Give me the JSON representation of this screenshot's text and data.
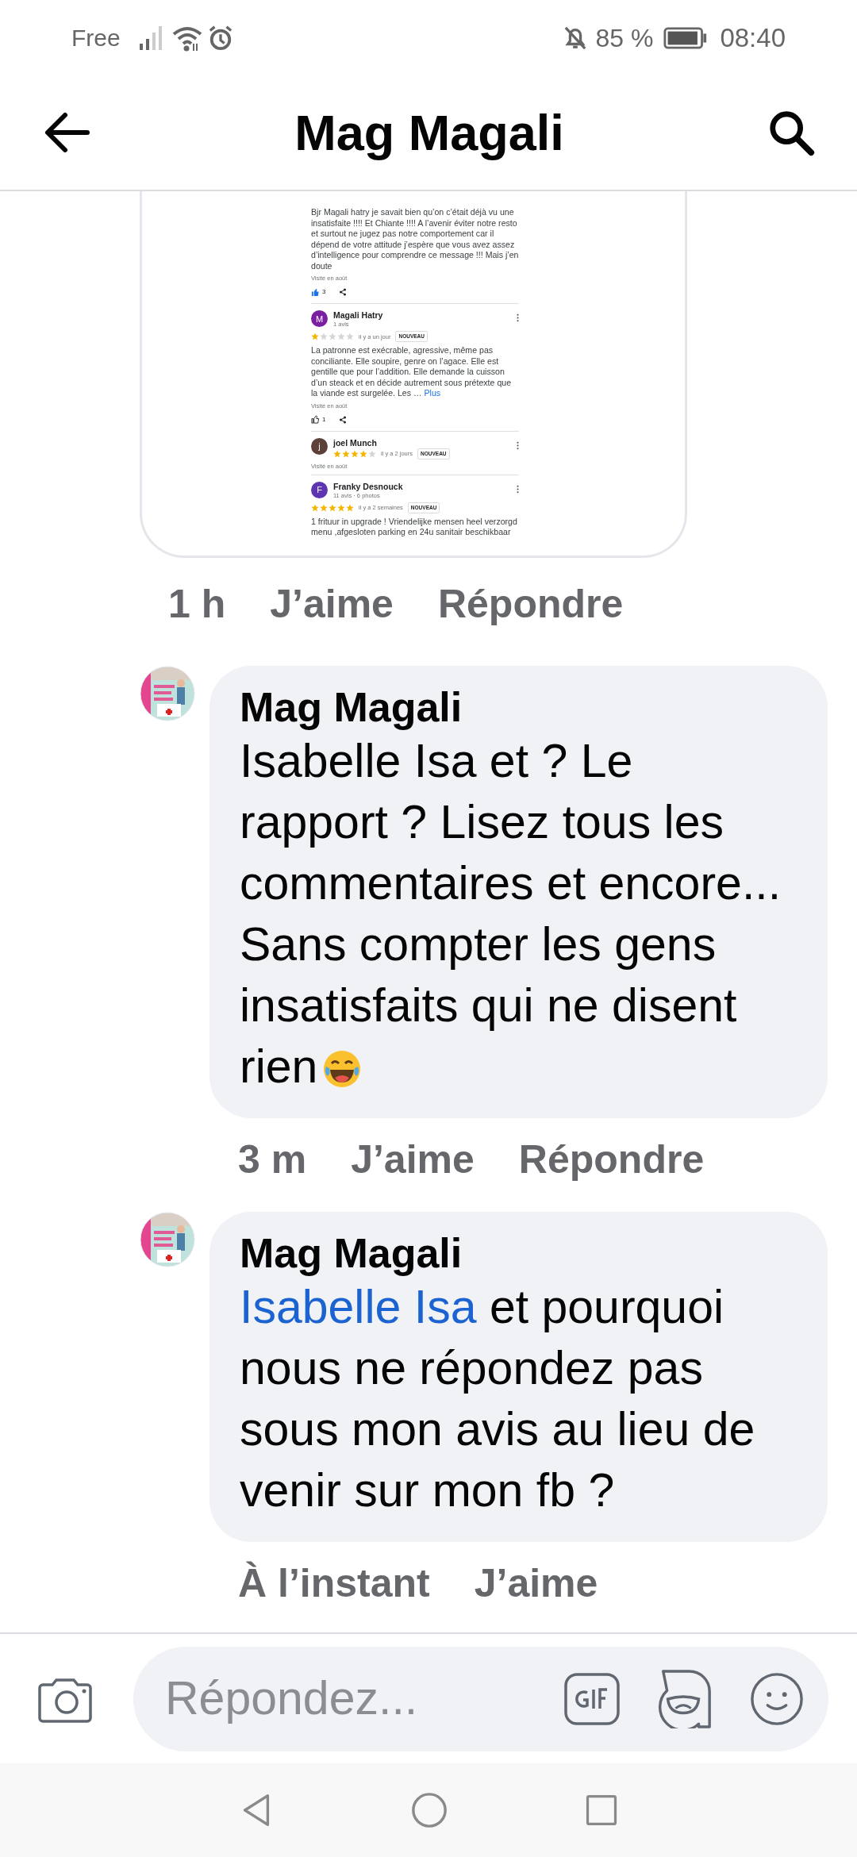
{
  "status_bar": {
    "carrier": "Free",
    "battery": "85 %",
    "time": "08:40"
  },
  "header": {
    "title": "Mag Magali"
  },
  "attachment": {
    "reviews": [
      {
        "text": "Bjr Magali hatry  je savait bien qu’on c’était déjà vu une insatisfaite !!!! Et Chiante !!!! A l’avenir éviter notre resto et surtout ne jugez pas notre comportement car il dépend de votre attitude  j’espère que vous avez assez d’intelligence pour comprendre ce message !!! Mais j’en doute",
        "visited": "Visité en août",
        "likes": "3",
        "liked": true
      },
      {
        "initial": "M",
        "color": "#7b1fa2",
        "name": "Magali Hatry",
        "meta": "1 avis",
        "stars": 1,
        "time": "il y a un jour",
        "badge": "NOUVEAU",
        "text": "La patronne est exécrable, agressive, même pas conciliante. Elle soupire, genre on l’agace. Elle est gentille que pour l’addition. Elle demande la cuisson d’un steack et en décide autrement sous prétexte que la viande est surgelée. Les …",
        "more": "Plus",
        "visited": "Visité en août",
        "likes": "1",
        "liked": false
      },
      {
        "initial": "j",
        "color": "#5d4037",
        "name": "joel Munch",
        "stars": 4,
        "time": "il y a 2 jours",
        "badge": "NOUVEAU",
        "visited": "Visité en août"
      },
      {
        "initial": "F",
        "color": "#5e35b1",
        "name": "Franky Desnouck",
        "meta": "11 avis · 6 photos",
        "stars": 5,
        "time": "il y a 2 semaines",
        "badge": "NOUVEAU",
        "text": "1 frituur in upgrade ! Vriendelijke mensen heel verzorgd menu ,afgesloten parking en 24u sanitair beschikbaar"
      }
    ],
    "time": "1 h",
    "like": "J’aime",
    "reply": "Répondre"
  },
  "comments": [
    {
      "author": "Mag Magali",
      "text": "Isabelle Isa et ? Le rapport ? Lisez tous les commentaires et encore... Sans compter les gens insatisfaits qui ne disent rien",
      "time": "3 m",
      "like": "J’aime",
      "reply": "Répondre"
    },
    {
      "author": "Mag Magali",
      "mention": "Isabelle Isa",
      "text": "et pourquoi nous ne répondez pas sous mon avis au lieu de venir sur mon fb ?",
      "time": "À l’instant",
      "like": "J’aime"
    }
  ],
  "composer": {
    "placeholder": "Répondez..."
  }
}
